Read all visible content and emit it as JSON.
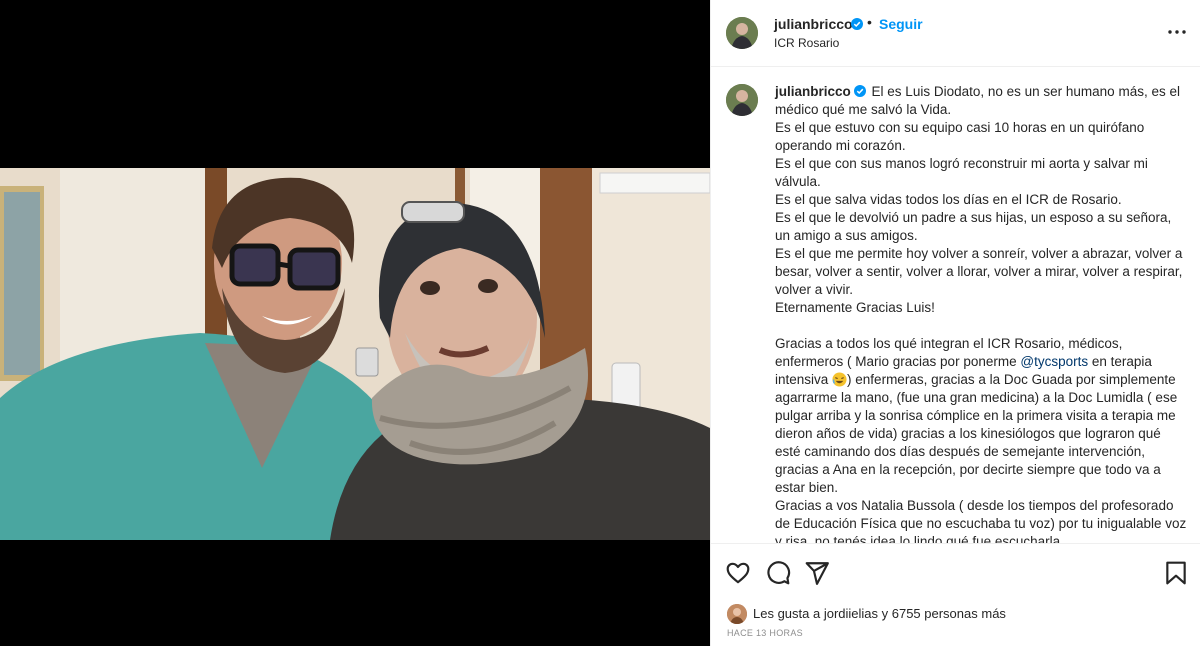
{
  "post": {
    "username": "julianbricco",
    "follow_label": "Seguir",
    "separator": "•",
    "location": "ICR Rosario",
    "more_icon": "more-horizontal-icon",
    "verified_icon": "verified-badge-icon"
  },
  "caption": {
    "username": "julianbricco",
    "p1": "El es Luis Diodato, no es un ser humano más, es el médico qué me salvó la Vida.",
    "p2": "Es el que estuvo con su equipo casi 10 horas en un quirófano operando mi corazón.",
    "p3": "Es el que con sus manos logró reconstruir mi aorta y salvar mi válvula.",
    "p4": "Es el que salva vidas todos los días en el ICR de Rosario.",
    "p5": "Es el que le devolvió un padre a sus hijas, un esposo a su señora, un amigo a sus amigos.",
    "p6": "Es el que me permite hoy volver a sonreír, volver a abrazar, volver a besar, volver a sentir, volver a llorar, volver a mirar, volver a respirar, volver a vivir.",
    "p7": "Eternamente Gracias Luis!",
    "p8_a": "Gracias a todos los qué integran el ICR Rosario, médicos, enfermeros ( Mario gracias por ponerme ",
    "p8_mention": "@tycsports",
    "p8_b": " en terapia intensiva ",
    "p8_c": ") enfermeras, gracias a la Doc Guada por simplemente agarrarme la mano, (fue una gran medicina) a la Doc Lumidla ( ese pulgar arriba y la sonrisa cómplice en la primera visita a terapia me dieron años de vida) gracias a los kinesiólogos que lograron qué esté caminando dos días después de semejante intervención, gracias a Ana en la recepción, por decirte siempre que todo va a estar bien.",
    "p9": "Gracias a vos Natalia Bussola ( desde los tiempos del profesorado de Educación Física que no escuchaba tu voz) por tu inigualable voz y risa, no tenés idea lo lindo qué fue escucharla"
  },
  "actions": {
    "like_icon": "heart-icon",
    "comment_icon": "comment-icon",
    "share_icon": "share-icon",
    "save_icon": "bookmark-icon"
  },
  "likes": {
    "text": "Les gusta a jordiielias y 6755 personas más"
  },
  "time_ago": "HACE 13 HORAS"
}
